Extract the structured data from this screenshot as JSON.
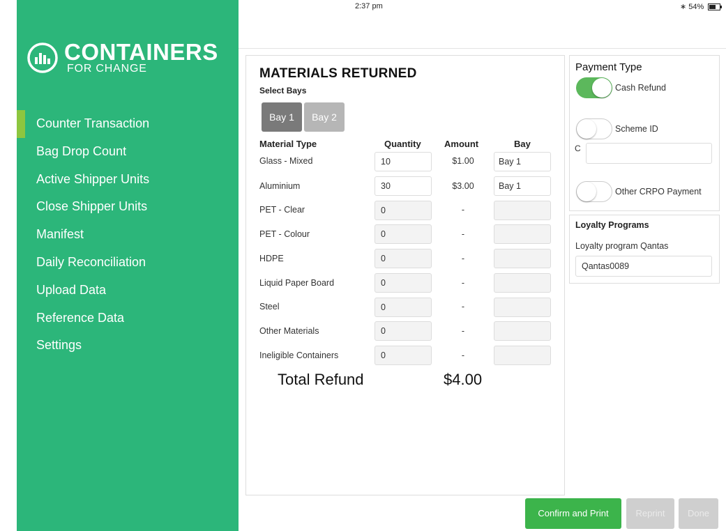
{
  "status_bar": {
    "device": "iPad",
    "time": "2:37 pm",
    "battery": "54%",
    "battery_level": 0.54
  },
  "brand": {
    "name": "CONTAINERS",
    "tagline": "FOR CHANGE",
    "color": "#2cb67a"
  },
  "sidebar": {
    "items": [
      {
        "label": "Counter Transaction",
        "active": true
      },
      {
        "label": "Bag Drop Count"
      },
      {
        "label": "Active Shipper Units"
      },
      {
        "label": "Close Shipper Units"
      },
      {
        "label": "Manifest"
      },
      {
        "label": "Daily Reconciliation"
      },
      {
        "label": "Upload Data"
      },
      {
        "label": "Reference Data"
      },
      {
        "label": "Settings"
      }
    ]
  },
  "materials": {
    "title": "MATERIALS RETURNED",
    "select_bays_label": "Select Bays",
    "bays": [
      {
        "label": "Bay 1",
        "selected": true
      },
      {
        "label": "Bay 2",
        "selected": false
      }
    ],
    "columns": {
      "material": "Material Type",
      "quantity": "Quantity",
      "amount": "Amount",
      "bay": "Bay"
    },
    "rows": [
      {
        "material": "Glass - Mixed",
        "quantity": "10",
        "amount": "$1.00",
        "bay": "Bay 1"
      },
      {
        "material": "Aluminium",
        "quantity": "30",
        "amount": "$3.00",
        "bay": "Bay 1"
      },
      {
        "material": "PET - Clear",
        "quantity": "0",
        "amount": "-",
        "bay": ""
      },
      {
        "material": "PET - Colour",
        "quantity": "0",
        "amount": "-",
        "bay": ""
      },
      {
        "material": "HDPE",
        "quantity": "0",
        "amount": "-",
        "bay": ""
      },
      {
        "material": "Liquid Paper Board",
        "quantity": "0",
        "amount": "-",
        "bay": ""
      },
      {
        "material": "Steel",
        "quantity": "0",
        "amount": "-",
        "bay": ""
      },
      {
        "material": "Other Materials",
        "quantity": "0",
        "amount": "-",
        "bay": ""
      },
      {
        "material": "Ineligible Containers",
        "quantity": "0",
        "amount": "-",
        "bay": ""
      }
    ],
    "total_label": "Total Refund",
    "total_value": "$4.00"
  },
  "payment": {
    "title": "Payment Type",
    "options": [
      {
        "label": "Cash Refund",
        "on": true
      },
      {
        "label": "Scheme ID",
        "on": false
      },
      {
        "label": "Other CRPO Payment",
        "on": false
      }
    ],
    "scheme_prefix": "C",
    "scheme_value": ""
  },
  "loyalty": {
    "title": "Loyalty Programs",
    "label": "Loyalty program Qantas",
    "value": "Qantas0089"
  },
  "actions": {
    "confirm": "Confirm and Print",
    "reprint": "Reprint",
    "done": "Done"
  }
}
